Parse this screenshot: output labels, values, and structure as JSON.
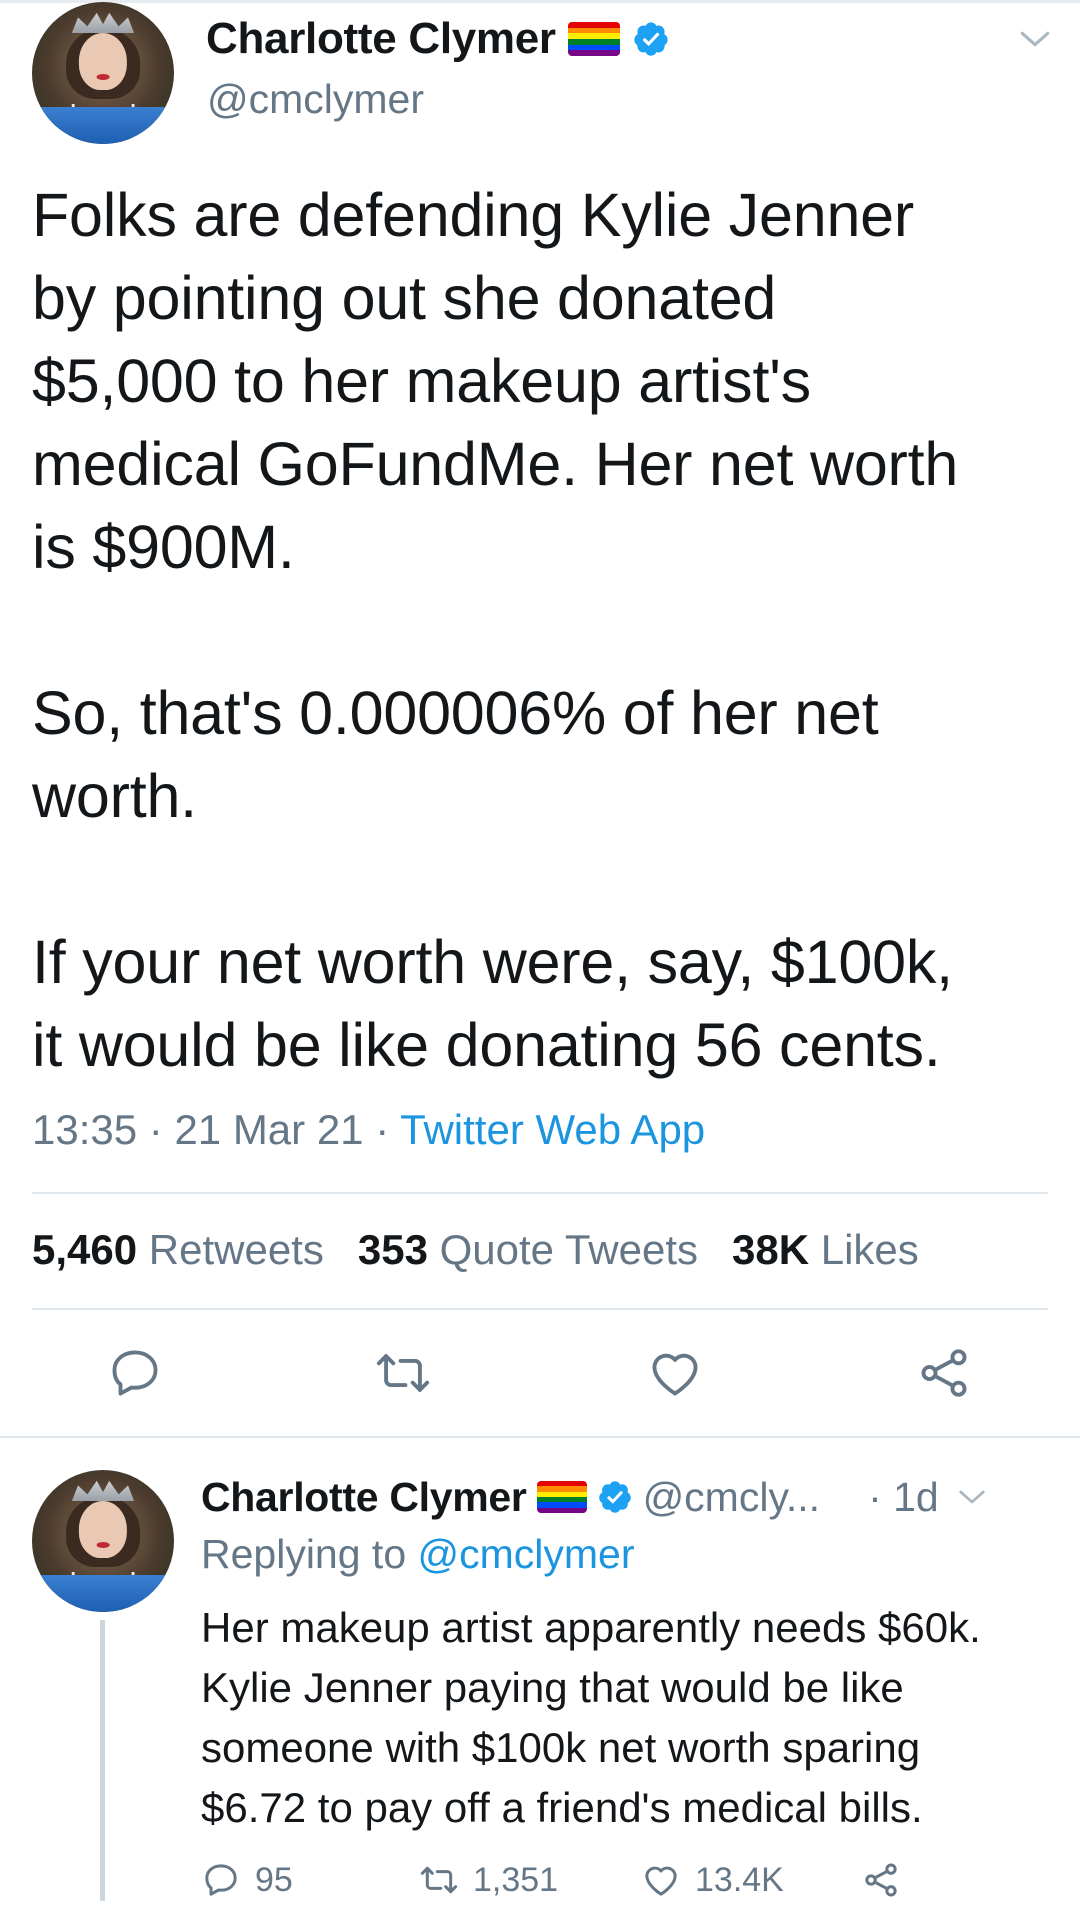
{
  "tweet": {
    "author": {
      "display_name": "Charlotte Clymer",
      "handle": "@cmclymer",
      "flag_icon": "rainbow-flag-icon",
      "verified_icon": "verified-badge-icon"
    },
    "text": "Folks are defending Kylie Jenner\nby pointing out she donated\n$5,000 to her makeup artist's\nmedical GoFundMe. Her net worth\nis $900M.\n\nSo, that's 0.000006% of her net\nworth.\n\nIf your net worth were, say, $100k,\nit would be like donating 56 cents.",
    "time": "13:35",
    "sep1": " · ",
    "date": "21 Mar 21",
    "sep2": " · ",
    "source": "Twitter Web App",
    "stats": {
      "retweets_count": "5,460",
      "retweets_label": "Retweets",
      "quotes_count": "353",
      "quotes_label": "Quote Tweets",
      "likes_count": "38K",
      "likes_label": "Likes"
    },
    "actions": [
      "reply-icon",
      "retweet-icon",
      "like-icon",
      "share-icon"
    ]
  },
  "reply": {
    "author": {
      "display_name": "Charlotte Clymer",
      "handle": "@cmcly...",
      "time": "· 1d"
    },
    "replying_prefix": "Replying to ",
    "replying_to": "@cmclymer",
    "text": "Her makeup artist apparently needs $60k.\nKylie Jenner paying that would be like\nsomeone with $100k net worth sparing\n$6.72 to pay off a friend's medical bills.",
    "counts": {
      "replies": "95",
      "retweets": "1,351",
      "likes": "13.4K"
    }
  },
  "colors": {
    "text": "#14171a",
    "secondary": "#657786",
    "link": "#1b95e0",
    "divider": "#e1e8ed"
  }
}
